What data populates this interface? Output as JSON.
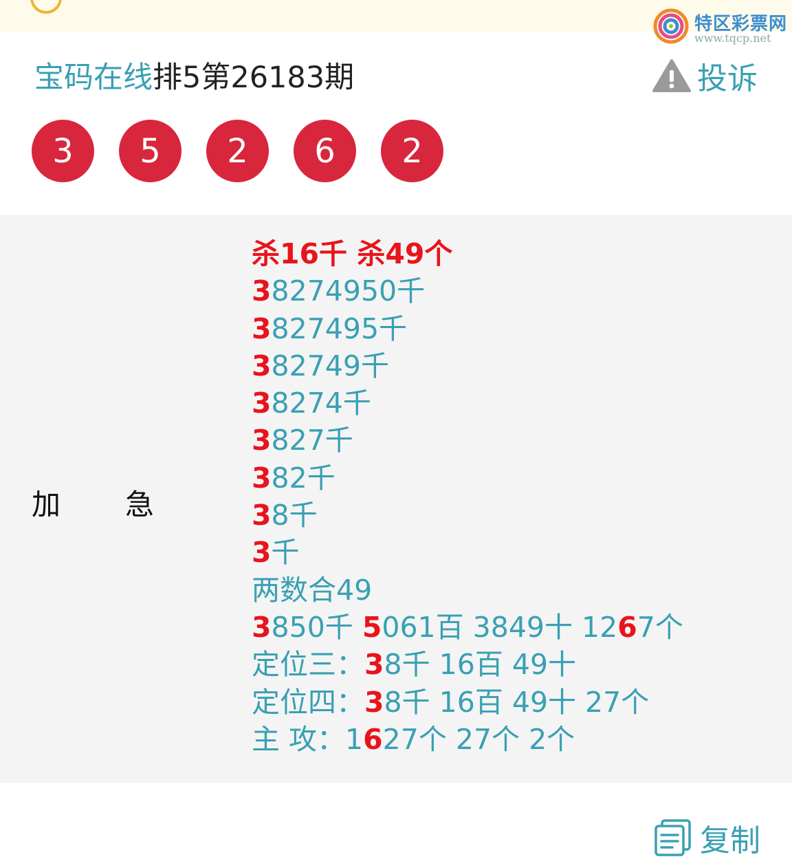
{
  "notice": {
    "text": ""
  },
  "watermark": {
    "title": "特区彩票网",
    "url": "www.tqcp.net"
  },
  "header": {
    "site_name": "宝码在线",
    "issue": "排5第26183期",
    "complaint_label": "投诉"
  },
  "balls": [
    "3",
    "5",
    "2",
    "6",
    "2"
  ],
  "prediction": {
    "label_left": "加",
    "label_right": "急",
    "lines": [
      {
        "head": true,
        "parts": [
          {
            "t": "杀16千 杀49个",
            "hl": false
          }
        ]
      },
      {
        "parts": [
          {
            "t": "3",
            "hl": true
          },
          {
            "t": "8274950千",
            "hl": false
          }
        ]
      },
      {
        "parts": [
          {
            "t": "3",
            "hl": true
          },
          {
            "t": "827495千",
            "hl": false
          }
        ]
      },
      {
        "parts": [
          {
            "t": "3",
            "hl": true
          },
          {
            "t": "82749千",
            "hl": false
          }
        ]
      },
      {
        "parts": [
          {
            "t": "3",
            "hl": true
          },
          {
            "t": "8274千",
            "hl": false
          }
        ]
      },
      {
        "parts": [
          {
            "t": "3",
            "hl": true
          },
          {
            "t": "827千",
            "hl": false
          }
        ]
      },
      {
        "parts": [
          {
            "t": "3",
            "hl": true
          },
          {
            "t": "82千",
            "hl": false
          }
        ]
      },
      {
        "parts": [
          {
            "t": "3",
            "hl": true
          },
          {
            "t": "8千",
            "hl": false
          }
        ]
      },
      {
        "parts": [
          {
            "t": "3",
            "hl": true
          },
          {
            "t": "千",
            "hl": false
          }
        ]
      },
      {
        "parts": [
          {
            "t": "两数合49",
            "hl": false
          }
        ]
      },
      {
        "parts": [
          {
            "t": "3",
            "hl": true
          },
          {
            "t": "850千 ",
            "hl": false
          },
          {
            "t": "5",
            "hl": true
          },
          {
            "t": "061百 3849十 12",
            "hl": false
          },
          {
            "t": "6",
            "hl": true
          },
          {
            "t": "7个",
            "hl": false
          }
        ]
      },
      {
        "parts": [
          {
            "t": "定位三：",
            "hl": false
          },
          {
            "t": "3",
            "hl": true
          },
          {
            "t": "8千 16百 49十",
            "hl": false
          }
        ]
      },
      {
        "parts": [
          {
            "t": "定位四：",
            "hl": false
          },
          {
            "t": "3",
            "hl": true
          },
          {
            "t": "8千 16百 49十 27个",
            "hl": false
          }
        ]
      },
      {
        "parts": [
          {
            "t": "主 攻：1",
            "hl": false
          },
          {
            "t": "6",
            "hl": true
          },
          {
            "t": "27个 27个 2个",
            "hl": false
          }
        ]
      }
    ]
  },
  "footer": {
    "copy_label": "复制"
  },
  "colors": {
    "accent": "#39a0b3",
    "ball": "#d8263d",
    "highlight": "#e8141b",
    "panel": "#f4f4f4"
  }
}
